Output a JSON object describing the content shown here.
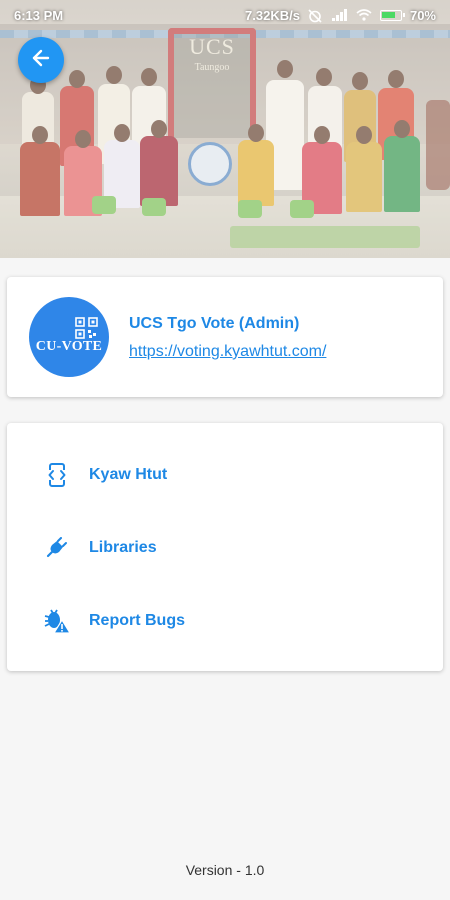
{
  "status_bar": {
    "time": "6:13 PM",
    "network_speed": "7.32KB/s",
    "battery": "70%"
  },
  "header": {
    "back_icon": "arrow-left-icon",
    "photo_sign": "UCS",
    "photo_sign_sub": "Taungoo"
  },
  "app_info": {
    "logo_text": "CU-VOTE",
    "title": "UCS Tgo Vote (Admin)",
    "link": "https://voting.kyawhtut.com/"
  },
  "menu": {
    "items": [
      {
        "label": "Kyaw Htut",
        "icon": "developer-mode-icon"
      },
      {
        "label": "Libraries",
        "icon": "plug-icon"
      },
      {
        "label": "Report Bugs",
        "icon": "bug-report-icon"
      }
    ]
  },
  "footer": {
    "version": "Version - 1.0"
  },
  "colors": {
    "accent": "#1e88e5",
    "fab": "#2196f3",
    "background": "#f6f6f6"
  }
}
